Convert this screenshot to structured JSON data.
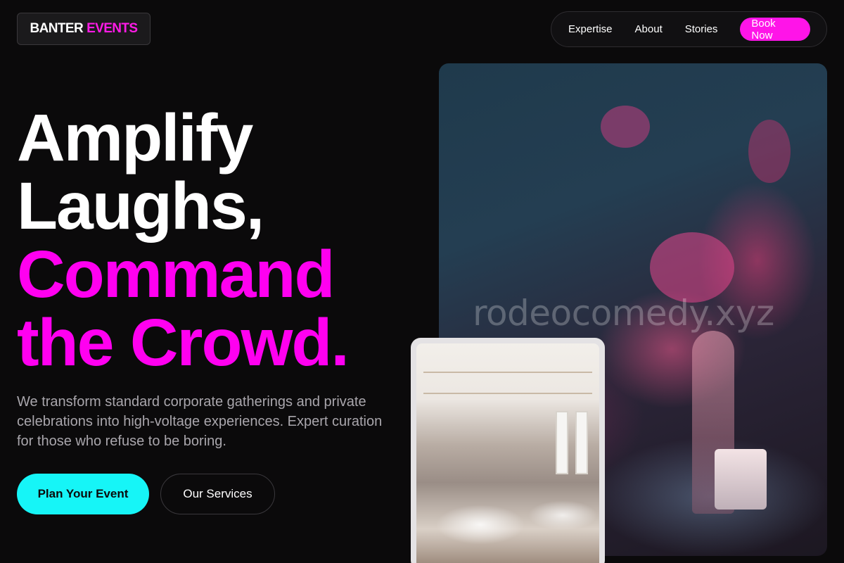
{
  "brand": {
    "word1": "BANTER",
    "word2": "EVENTS"
  },
  "nav": {
    "items": [
      {
        "label": "Expertise"
      },
      {
        "label": "About"
      },
      {
        "label": "Stories"
      }
    ],
    "cta": "Book Now"
  },
  "hero": {
    "headline_lines": [
      {
        "text": "Amplify",
        "style": "white"
      },
      {
        "text": "Laughs,",
        "style": "white"
      },
      {
        "text": "Command",
        "style": "pink"
      },
      {
        "text": "the Crowd.",
        "style": "pink"
      }
    ],
    "subtext": "We transform standard corporate gatherings and private celebrations into high-voltage experiences. Expert curation for those who refuse to be boring.",
    "primary_button": "Plan Your Event",
    "secondary_button": "Our Services",
    "watermark": "rodeocomedy.xyz"
  },
  "colors": {
    "background": "#0b0a0b",
    "accent_pink": "#ff00f0",
    "accent_cyan": "#16f5f7"
  }
}
